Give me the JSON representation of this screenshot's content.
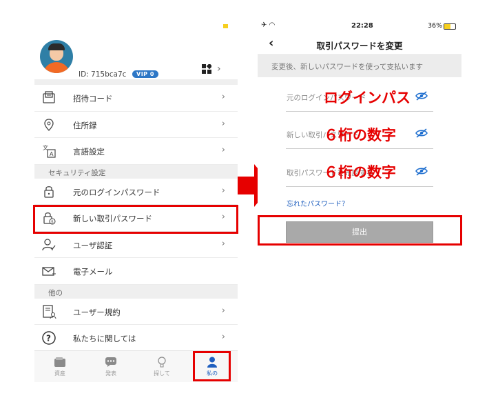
{
  "left": {
    "profile": {
      "user_id": "ID: 715bca7c",
      "vip_badge": "VIP 0"
    },
    "menu_main": [
      {
        "name": "invite-code",
        "label": "招待コード"
      },
      {
        "name": "address-book",
        "label": "住所録"
      },
      {
        "name": "language-settings",
        "label": "言語設定"
      }
    ],
    "section_security": "セキュリティ設定",
    "menu_security": [
      {
        "name": "original-login-password",
        "label": "元のログインパスワード"
      },
      {
        "name": "new-trade-password",
        "label": "新しい取引パスワード"
      },
      {
        "name": "user-verification",
        "label": "ユーザ認証"
      },
      {
        "name": "email",
        "label": "電子メール"
      }
    ],
    "section_other": "他の",
    "menu_other": [
      {
        "name": "user-agreement",
        "label": "ユーザー規約"
      },
      {
        "name": "about-us",
        "label": "私たちに関しては"
      }
    ],
    "tabs": [
      {
        "name": "assets",
        "label": "資産",
        "icon": "wallet-icon"
      },
      {
        "name": "publish",
        "label": "発表",
        "icon": "chat-icon"
      },
      {
        "name": "explore",
        "label": "探して",
        "icon": "lightbulb-icon"
      },
      {
        "name": "me",
        "label": "私の",
        "icon": "person-icon",
        "active": true
      }
    ]
  },
  "right": {
    "status": {
      "time": "22:28",
      "battery": "36%"
    },
    "nav_title": "取引パスワードを変更",
    "hint": "変更後、新しいパスワードを使って支払います",
    "fields": [
      {
        "name": "original-login-password",
        "placeholder": "元のログインパスワード",
        "overlay": "ログインパス"
      },
      {
        "name": "new-trade-password",
        "placeholder": "新しい取引パスワード",
        "overlay": "６桁の数字"
      },
      {
        "name": "confirm-trade-password",
        "placeholder": "取引パスワードを確認する",
        "overlay": "６桁の数字"
      }
    ],
    "forgot": "忘れたパスワード？",
    "submit": "提出"
  },
  "colors": {
    "highlight": "#e60000",
    "accent": "#1f5fbf",
    "vip": "#2d77c6",
    "button": "#a9a9a9"
  }
}
